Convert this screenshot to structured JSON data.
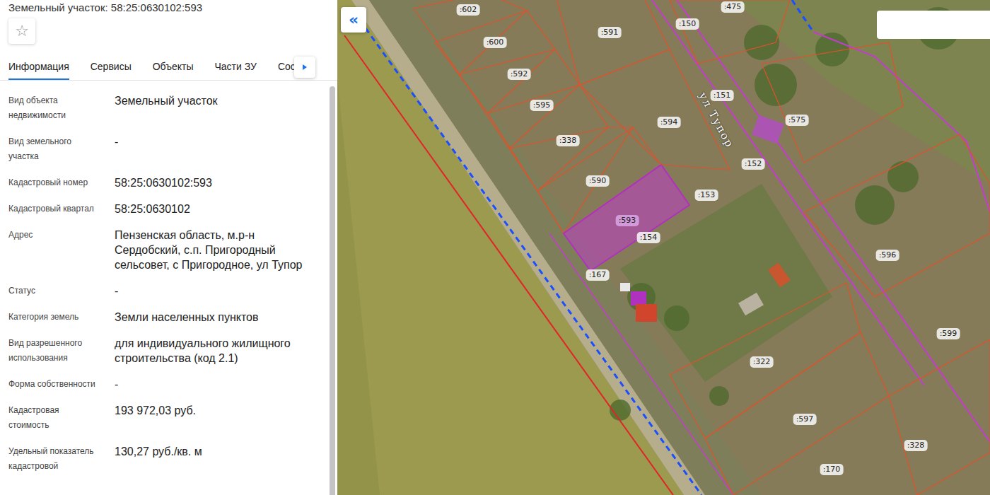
{
  "panel": {
    "title": "Земельный участок: 58:25:0630102:593",
    "favorite_icon": "☆"
  },
  "tabs": [
    {
      "label": "Информация",
      "selected": true
    },
    {
      "label": "Сервисы",
      "selected": false
    },
    {
      "label": "Объекты",
      "selected": false
    },
    {
      "label": "Части ЗУ",
      "selected": false
    },
    {
      "label": "Соста",
      "selected": false
    }
  ],
  "fields": [
    {
      "label": "Вид объекта недвижимости",
      "value": "Земельный участок"
    },
    {
      "label": "Вид земельного участка",
      "value": "-"
    },
    {
      "label": "Кадастровый номер",
      "value": "58:25:0630102:593"
    },
    {
      "label": "Кадастровый квартал",
      "value": "58:25:0630102"
    },
    {
      "label": "Адрес",
      "value": "Пензенская область, м.р-н Сердобский, с.п. Пригородный сельсовет, с Пригородное, ул Тупор"
    },
    {
      "label": "Статус",
      "value": "-"
    },
    {
      "label": "Категория земель",
      "value": "Земли населенных пунктов"
    },
    {
      "label": "Вид разрешенного использования",
      "value": "для индивидуального жилищного строительства (код 2.1)"
    },
    {
      "label": "Форма собственности",
      "value": "-"
    },
    {
      "label": "Кадастровая стоимость",
      "value": "193 972,03 руб."
    },
    {
      "label": "Удельный показатель кадастровой",
      "value": "130,27 руб./кв. м"
    }
  ],
  "map": {
    "collapse": "«",
    "street": "ул Тупор",
    "parcels": [
      {
        "label": ":602",
        "selected": false
      },
      {
        "label": ":600",
        "selected": false
      },
      {
        "label": ":591",
        "selected": false
      },
      {
        "label": ":592",
        "selected": false
      },
      {
        "label": ":595",
        "selected": false
      },
      {
        "label": ":594",
        "selected": false
      },
      {
        "label": ":338",
        "selected": false
      },
      {
        "label": ":590",
        "selected": false
      },
      {
        "label": ":593",
        "selected": true
      },
      {
        "label": ":153",
        "selected": false
      },
      {
        "label": ":154",
        "selected": false
      },
      {
        "label": ":167",
        "selected": false
      },
      {
        "label": ":150",
        "selected": false
      },
      {
        "label": ":475",
        "selected": false
      },
      {
        "label": ":151",
        "selected": false
      },
      {
        "label": ":575",
        "selected": false
      },
      {
        "label": ":152",
        "selected": false
      },
      {
        "label": ":596",
        "selected": false
      },
      {
        "label": ":599",
        "selected": false
      },
      {
        "label": ":322",
        "selected": false
      },
      {
        "label": ":597",
        "selected": false
      },
      {
        "label": ":328",
        "selected": false
      },
      {
        "label": ":170",
        "selected": false
      }
    ]
  }
}
